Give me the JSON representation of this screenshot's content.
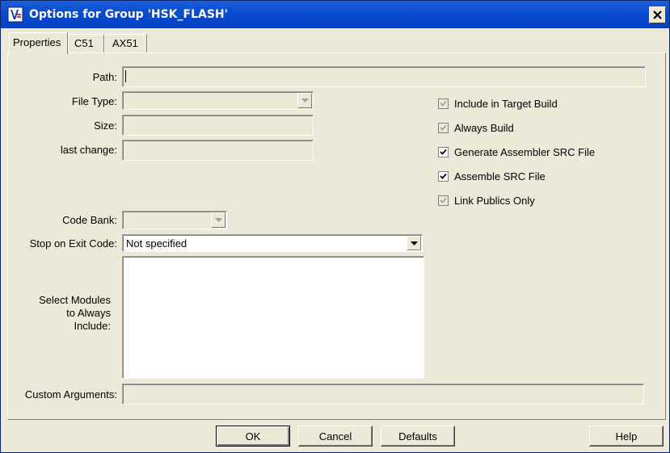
{
  "window": {
    "title": "Options for Group 'HSK_FLASH'",
    "icon": "uvision-icon",
    "close_icon": "close-icon"
  },
  "tabs": [
    {
      "label": "Properties",
      "active": true
    },
    {
      "label": "C51",
      "active": false
    },
    {
      "label": "AX51",
      "active": false
    }
  ],
  "properties": {
    "path_label": "Path:",
    "path_value": "",
    "file_type_label": "File Type:",
    "file_type_value": "",
    "size_label": "Size:",
    "size_value": "",
    "last_change_label": "last change:",
    "last_change_value": "",
    "code_bank_label": "Code Bank:",
    "code_bank_value": "",
    "stop_on_exit_label": "Stop on Exit Code:",
    "stop_on_exit_value": "Not specified",
    "select_modules_label_1": "Select Modules",
    "select_modules_label_2": "to Always",
    "select_modules_label_3": "Include:",
    "custom_args_label": "Custom Arguments:",
    "custom_args_value": ""
  },
  "checkboxes": [
    {
      "label": "Include in Target Build",
      "checked": true,
      "enabled": false
    },
    {
      "label": "Always Build",
      "checked": true,
      "enabled": false
    },
    {
      "label": "Generate Assembler SRC File",
      "checked": true,
      "enabled": true
    },
    {
      "label": "Assemble SRC File",
      "checked": true,
      "enabled": true
    },
    {
      "label": "Link Publics Only",
      "checked": true,
      "enabled": false
    }
  ],
  "buttons": {
    "ok": "OK",
    "cancel": "Cancel",
    "defaults": "Defaults",
    "help": "Help"
  }
}
